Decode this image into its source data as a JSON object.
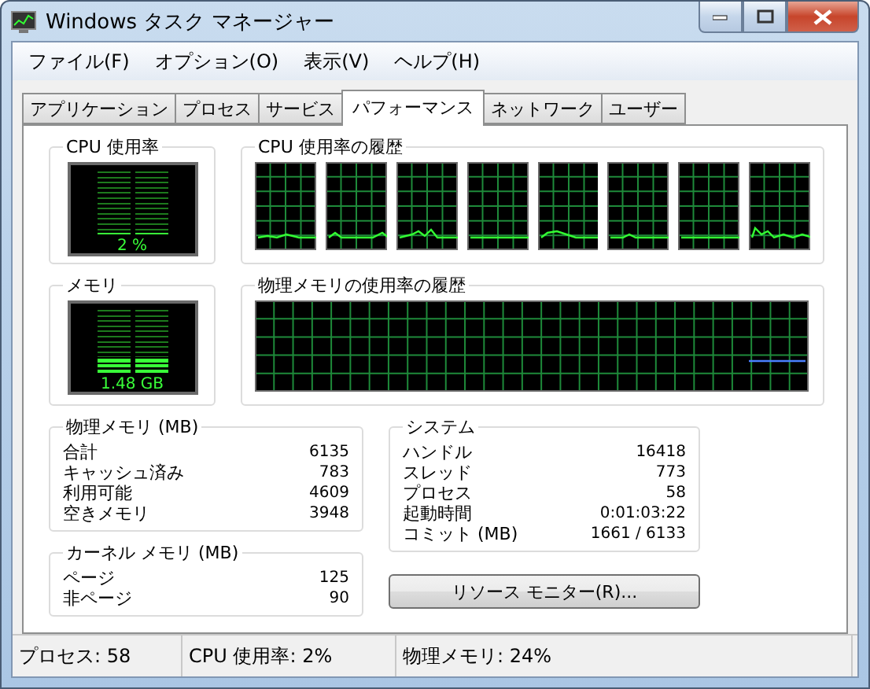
{
  "window": {
    "title": "Windows タスク マネージャー"
  },
  "menu": [
    "ファイル(F)",
    "オプション(O)",
    "表示(V)",
    "ヘルプ(H)"
  ],
  "tabs": [
    {
      "label": "アプリケーション",
      "selected": false
    },
    {
      "label": "プロセス",
      "selected": false
    },
    {
      "label": "サービス",
      "selected": false
    },
    {
      "label": "パフォーマンス",
      "selected": true
    },
    {
      "label": "ネットワーク",
      "selected": false
    },
    {
      "label": "ユーザー",
      "selected": false
    }
  ],
  "cpu_usage": {
    "label": "CPU 使用率",
    "reading": "2 %",
    "level": 0.02
  },
  "cpu_history": {
    "label": "CPU 使用率の履歴"
  },
  "memory": {
    "label": "メモリ",
    "reading": "1.48 GB",
    "level": 0.24
  },
  "memory_history": {
    "label": "物理メモリの使用率の履歴"
  },
  "physical_memory": {
    "title": "物理メモリ (MB)",
    "rows": [
      {
        "label": "合計",
        "value": "6135"
      },
      {
        "label": "キャッシュ済み",
        "value": "783"
      },
      {
        "label": "利用可能",
        "value": "4609"
      },
      {
        "label": "空きメモリ",
        "value": "3948"
      }
    ]
  },
  "kernel_memory": {
    "title": "カーネル メモリ (MB)",
    "rows": [
      {
        "label": "ページ",
        "value": "125"
      },
      {
        "label": "非ページ",
        "value": "90"
      }
    ]
  },
  "system": {
    "title": "システム",
    "rows": [
      {
        "label": "ハンドル",
        "value": "16418"
      },
      {
        "label": "スレッド",
        "value": "773"
      },
      {
        "label": "プロセス",
        "value": "58"
      },
      {
        "label": "起動時間",
        "value": "0:01:03:22"
      },
      {
        "label": "コミット (MB)",
        "value": "1661 / 6133"
      }
    ]
  },
  "button": "リソース モニター(R)...",
  "status_bar": [
    "プロセス: 58",
    "CPU 使用率: 2%",
    "物理メモリ: 24%"
  ]
}
